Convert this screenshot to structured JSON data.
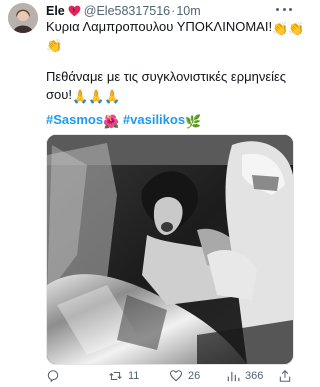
{
  "author": {
    "name": "Ele",
    "handle": "@Ele58317516",
    "separator": "·",
    "time": "10m"
  },
  "tweet": {
    "line1": "Κυρια Λαμπροπουλου ΥΠΟΚΛΙΝΟΜΑΙ!",
    "line3": "Πεθάναμε με τις συγκλονιστικές ερμηνείες",
    "line4": "σου!",
    "hashtag1": "#Sasmos",
    "hashtag2": "#vasilikos"
  },
  "actions": {
    "retweets": "11",
    "likes": "26",
    "views": "366"
  },
  "colors": {
    "link": "#1d9bf0",
    "muted": "#536471",
    "heart": "#e0245e"
  },
  "icons": [
    "heart-icon",
    "more-icon",
    "clap-emoji",
    "pray-emoji",
    "rose-emoji",
    "herb-emoji",
    "reply-icon",
    "retweet-icon",
    "like-icon",
    "views-icon",
    "share-icon"
  ]
}
